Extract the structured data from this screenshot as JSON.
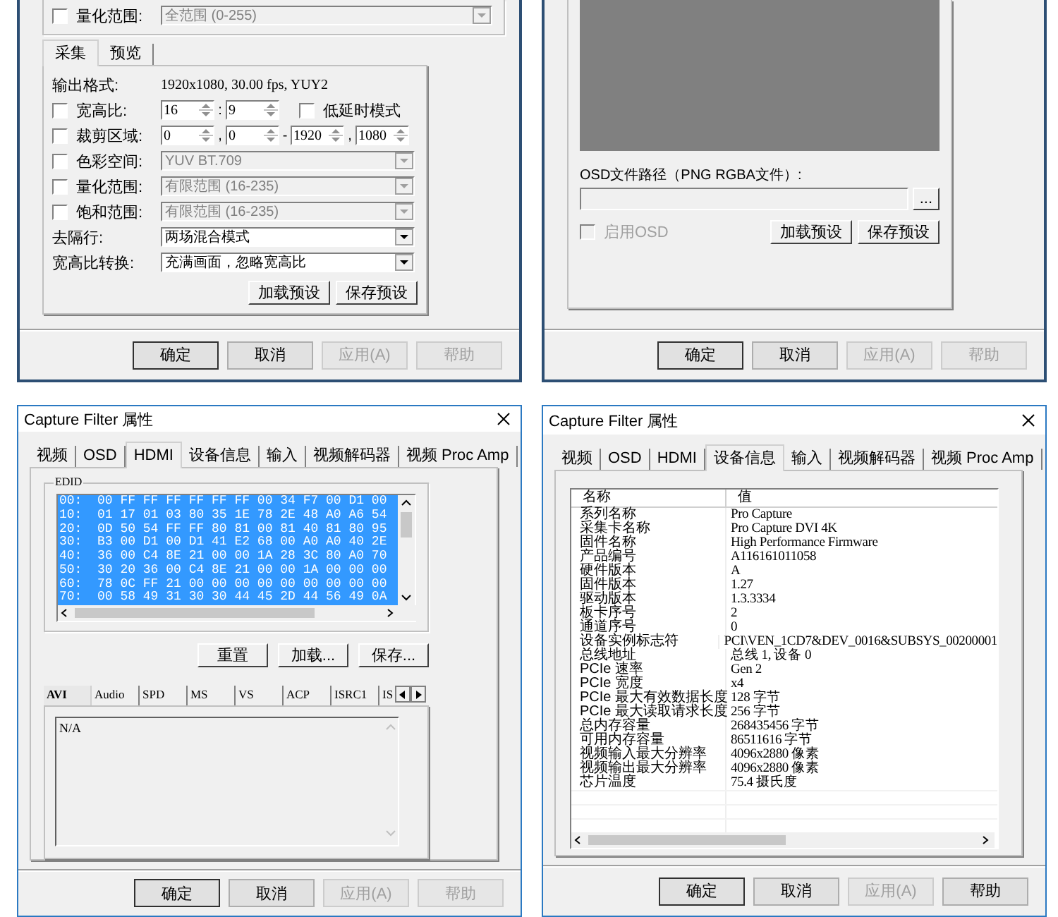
{
  "dialogs": [
    {
      "kind": "settings",
      "group": {
        "rows": [
          {
            "label": "量化范围:",
            "checked": false,
            "value": "全范围 (0-255)",
            "disabled": true
          }
        ]
      },
      "tabs": [
        {
          "label": "采集",
          "selected": true
        },
        {
          "label": "预览",
          "selected": false
        }
      ],
      "rows": [
        {
          "kind": "info",
          "label": "输出格式:",
          "value": "1920x1080, 30.00 fps, YUY2"
        },
        {
          "kind": "spins",
          "label": "宽高比:",
          "checked": false,
          "fields": [
            "16",
            "9"
          ],
          "separators": [
            ":"
          ],
          "option": {
            "label": "低延时模式",
            "checked": false
          }
        },
        {
          "kind": "spins",
          "label": "裁剪区域:",
          "checked": false,
          "fields": [
            "0",
            "0",
            "1920",
            "1080"
          ],
          "separators": [
            ",",
            "-",
            ","
          ]
        },
        {
          "kind": "combo",
          "label": "色彩空间:",
          "checked": false,
          "value": "YUV BT.709",
          "disabled": true
        },
        {
          "kind": "combo",
          "label": "量化范围:",
          "checked": false,
          "value": "有限范围 (16-235)",
          "disabled": true
        },
        {
          "kind": "combo",
          "label": "饱和范围:",
          "checked": false,
          "value": "有限范围 (16-235)",
          "disabled": true
        },
        {
          "kind": "combo",
          "label": "去隔行:",
          "value": "两场混合模式",
          "disabled": false
        },
        {
          "kind": "combo",
          "label": "宽高比转换:",
          "value": "充满画面，忽略宽高比",
          "disabled": false
        }
      ],
      "buttons": [
        "加载预设",
        "保存预设"
      ],
      "footer": [
        {
          "label": "确定",
          "default": true,
          "disabled": false
        },
        {
          "label": "取消",
          "default": false,
          "disabled": false
        },
        {
          "label": "应用(A)",
          "default": false,
          "disabled": true
        },
        {
          "label": "帮助",
          "default": false,
          "disabled": true
        }
      ]
    },
    {
      "kind": "osd",
      "path_label": "OSD文件路径（PNG RGBA文件）:",
      "browse": "...",
      "enable": {
        "label": "启用OSD",
        "checked": false,
        "disabled": true
      },
      "buttons": [
        "加载预设",
        "保存预设"
      ],
      "footer": [
        {
          "label": "确定",
          "default": true,
          "disabled": false
        },
        {
          "label": "取消",
          "default": false,
          "disabled": false
        },
        {
          "label": "应用(A)",
          "default": false,
          "disabled": true
        },
        {
          "label": "帮助",
          "default": false,
          "disabled": true
        }
      ]
    },
    {
      "kind": "hdmi",
      "title": "Capture Filter 属性",
      "tabs": [
        {
          "label": "视频",
          "selected": false
        },
        {
          "label": "OSD",
          "selected": false
        },
        {
          "label": "HDMI",
          "selected": true
        },
        {
          "label": "设备信息",
          "selected": false
        },
        {
          "label": "输入",
          "selected": false
        },
        {
          "label": "视频解码器",
          "selected": false
        },
        {
          "label": "视频 Proc Amp",
          "selected": false
        }
      ],
      "edid": {
        "label": "EDID",
        "lines": [
          {
            "text": "00:  00 FF FF FF FF FF FF 00 34 F7 00 D1 00",
            "selected": true
          },
          {
            "text": "10:  01 17 01 03 80 35 1E 78 2E 48 A0 A6 54",
            "selected": true
          },
          {
            "text": "20:  0D 50 54 FF FF 80 81 00 81 40 81 80 95",
            "selected": true
          },
          {
            "text": "30:  B3 00 D1 00 D1 41 E2 68 00 A0 A0 40 2E",
            "selected": true
          },
          {
            "text": "40:  36 00 C4 8E 21 00 00 1A 28 3C 80 A0 70",
            "selected": true
          },
          {
            "text": "50:  30 20 36 00 C4 8E 21 00 00 1A 00 00 00",
            "selected": true
          },
          {
            "text": "60:  78 0C FF 21 00 00 00 00 00 00 00 00 00",
            "selected": true
          },
          {
            "text": "70:  00 58 49 31 30 30 44 45 2D 44 56 49 0A",
            "selected": true
          }
        ]
      },
      "buttons": [
        "重置",
        "加载...",
        "保存..."
      ],
      "subtabs": [
        {
          "label": "AVI",
          "selected": true
        },
        {
          "label": "Audio",
          "selected": false
        },
        {
          "label": "SPD",
          "selected": false
        },
        {
          "label": "MS",
          "selected": false
        },
        {
          "label": "VS",
          "selected": false
        },
        {
          "label": "ACP",
          "selected": false
        },
        {
          "label": "ISRC1",
          "selected": false
        },
        {
          "label": "IS",
          "selected": false
        }
      ],
      "details": "N/A",
      "footer": [
        {
          "label": "确定",
          "default": true,
          "disabled": false
        },
        {
          "label": "取消",
          "default": false,
          "disabled": false
        },
        {
          "label": "应用(A)",
          "default": false,
          "disabled": true
        },
        {
          "label": "帮助",
          "default": false,
          "disabled": true
        }
      ]
    },
    {
      "kind": "device_info",
      "title": "Capture Filter 属性",
      "tabs": [
        {
          "label": "视频",
          "selected": false
        },
        {
          "label": "OSD",
          "selected": false
        },
        {
          "label": "HDMI",
          "selected": false
        },
        {
          "label": "设备信息",
          "selected": true
        },
        {
          "label": "输入",
          "selected": false
        },
        {
          "label": "视频解码器",
          "selected": false
        },
        {
          "label": "视频 Proc Amp",
          "selected": false
        }
      ],
      "table": {
        "columns": [
          "名称",
          "值"
        ],
        "rows": [
          [
            "系列名称",
            "Pro Capture"
          ],
          [
            "采集卡名称",
            "Pro Capture DVI 4K"
          ],
          [
            "固件名称",
            "High Performance Firmware"
          ],
          [
            "产品编号",
            "A116161011058"
          ],
          [
            "硬件版本",
            "A"
          ],
          [
            "固件版本",
            "1.27"
          ],
          [
            "驱动版本",
            "1.3.3334"
          ],
          [
            "板卡序号",
            "2"
          ],
          [
            "通道序号",
            "0"
          ],
          [
            "设备实例标志符",
            "PCI\\VEN_1CD7&DEV_0016&SUBSYS_00200001"
          ],
          [
            "总线地址",
            "总线 1, 设备 0"
          ],
          [
            "PCIe 速率",
            "Gen 2"
          ],
          [
            "PCIe 宽度",
            "x4"
          ],
          [
            "PCIe 最大有效数据长度",
            "128 字节"
          ],
          [
            "PCIe 最大读取请求长度",
            "256 字节"
          ],
          [
            "总内存容量",
            "268435456 字节"
          ],
          [
            "可用内存容量",
            "86511616 字节"
          ],
          [
            "视频输入最大分辨率",
            "4096x2880 像素"
          ],
          [
            "视频输出最大分辨率",
            "4096x2880 像素"
          ],
          [
            "芯片温度",
            "75.4 摄氏度"
          ]
        ]
      },
      "footer": [
        {
          "label": "确定",
          "default": true,
          "disabled": false
        },
        {
          "label": "取消",
          "default": false,
          "disabled": false
        },
        {
          "label": "应用(A)",
          "default": false,
          "disabled": true
        },
        {
          "label": "帮助",
          "default": false,
          "disabled": false
        }
      ]
    }
  ]
}
